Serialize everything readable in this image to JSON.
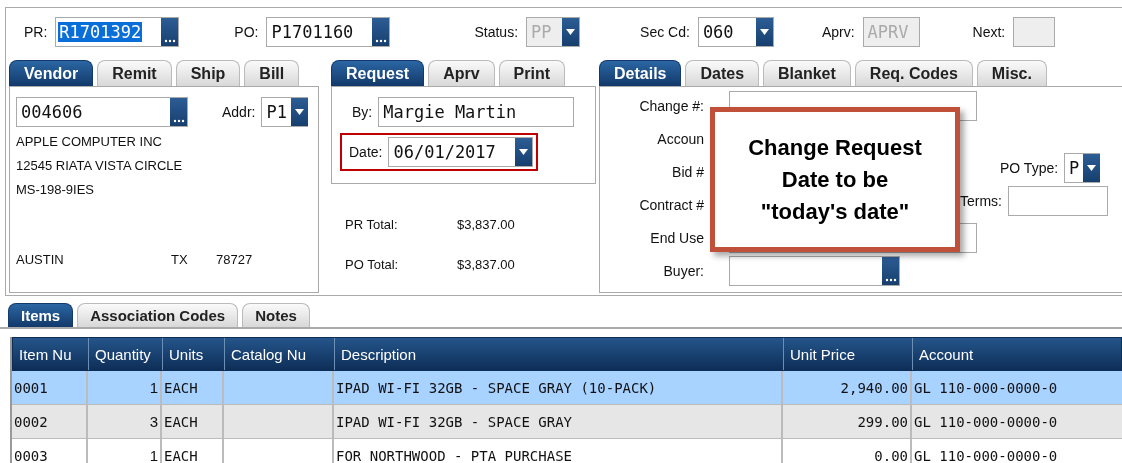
{
  "header_fields": [
    {
      "label": "PR:",
      "value": "R1701392",
      "kind": "lookup",
      "text_selected": true,
      "disabled": false
    },
    {
      "label": "PO:",
      "value": "P1701160",
      "kind": "lookup",
      "disabled": false
    },
    {
      "label": "Status:",
      "value": "PP",
      "kind": "select",
      "disabled": true
    },
    {
      "label": "Sec Cd:",
      "value": "060",
      "kind": "select",
      "disabled": false
    },
    {
      "label": "Aprv:",
      "value": "APRV",
      "kind": "text",
      "disabled": true
    },
    {
      "label": "Next:",
      "kind": "text",
      "disabled": true
    }
  ],
  "vendor_tabs": [
    {
      "label": "Vendor",
      "selected": true
    },
    {
      "label": "Remit",
      "selected": false
    },
    {
      "label": "Ship",
      "selected": false
    },
    {
      "label": "Bill",
      "selected": false
    }
  ],
  "vendor": {
    "number": "004606",
    "addr_label": "Addr:",
    "addr": "P1",
    "lines": [
      "APPLE COMPUTER INC",
      "12545 RIATA VISTA CIRCLE",
      "MS-198-9IES"
    ],
    "city": "AUSTIN",
    "state": "TX",
    "zip": "78727"
  },
  "request_tabs": [
    {
      "label": "Request",
      "selected": true
    },
    {
      "label": "Aprv",
      "selected": false
    },
    {
      "label": "Print",
      "selected": false
    }
  ],
  "request": {
    "by_label": "By:",
    "by": "Margie Martin",
    "date_label": "Date:",
    "date": "06/01/2017",
    "date_highlighted": true,
    "totals": [
      {
        "label": "PR Total:",
        "value": "$3,837.00"
      },
      {
        "label": "PO Total:",
        "value": "$3,837.00"
      }
    ]
  },
  "details_tabs": [
    {
      "label": "Details",
      "selected": true
    },
    {
      "label": "Dates",
      "selected": false
    },
    {
      "label": "Blanket",
      "selected": false
    },
    {
      "label": "Req. Codes",
      "selected": false
    },
    {
      "label": "Misc.",
      "selected": false
    }
  ],
  "details": {
    "rows": [
      {
        "label": "Change #:",
        "kind": "field"
      },
      {
        "label": "Accoun",
        "kind": "none"
      },
      {
        "label": "Bid #",
        "kind": "none"
      },
      {
        "label": "Contract #",
        "kind": "none"
      },
      {
        "label": "End Use",
        "kind": "field"
      },
      {
        "label": "Buyer:",
        "kind": "lookup"
      }
    ],
    "po_type_label": "PO Type:",
    "po_type": "P",
    "terms_label": "Terms:"
  },
  "callout": {
    "lines": [
      "Change Request",
      "Date to be",
      "\"today's date\""
    ]
  },
  "item_tabs": [
    {
      "label": "Items",
      "selected": true
    },
    {
      "label": "Association Codes",
      "selected": false
    },
    {
      "label": "Notes",
      "selected": false
    }
  ],
  "table": {
    "columns": [
      "Item Nu",
      "Quantity",
      "Units",
      "Catalog Nu",
      "Description",
      "Unit Price",
      "Account"
    ],
    "rows": [
      {
        "selected": true,
        "cells": [
          "0001",
          "1",
          "EACH",
          "",
          "IPAD WI-FI 32GB - SPACE GRAY (10-PACK)",
          "2,940.00",
          "GL 110-000-0000-0"
        ]
      },
      {
        "selected": false,
        "cells": [
          "0002",
          "3",
          "EACH",
          "",
          "IPAD WI-FI 32GB - SPACE GRAY",
          "299.00",
          "GL 110-000-0000-0"
        ]
      },
      {
        "selected": false,
        "cells": [
          "0003",
          "1",
          "EACH",
          "",
          "FOR NORTHWOOD - PTA PURCHASE",
          "0.00",
          "GL 110-000-0000-0"
        ]
      }
    ]
  }
}
